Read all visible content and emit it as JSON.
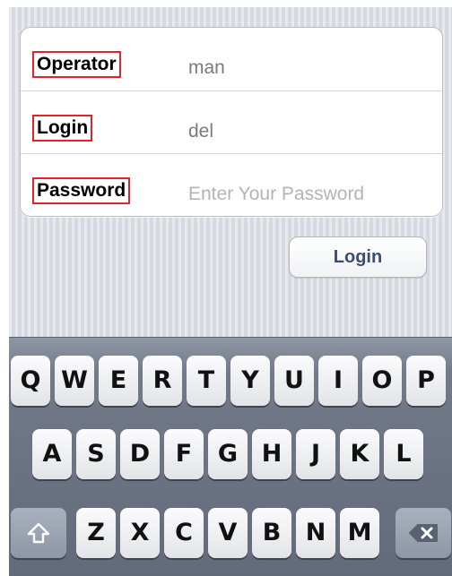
{
  "form": {
    "operator": {
      "label": "Operator",
      "value": "man"
    },
    "login": {
      "label": "Login",
      "value": "del"
    },
    "password": {
      "label": "Password",
      "placeholder": "Enter Your Password"
    }
  },
  "login_button": {
    "label": "Login"
  },
  "keyboard": {
    "row1": [
      "Q",
      "W",
      "E",
      "R",
      "T",
      "Y",
      "U",
      "I",
      "O",
      "P"
    ],
    "row2": [
      "A",
      "S",
      "D",
      "F",
      "G",
      "H",
      "J",
      "K",
      "L"
    ],
    "row3": [
      "Z",
      "X",
      "C",
      "V",
      "B",
      "N",
      "M"
    ],
    "shift_icon": "shift-arrow-icon",
    "delete_icon": "backspace-icon"
  },
  "colors": {
    "label_highlight": "#e3222b",
    "button_text": "#3b4d73",
    "keyboard_bg": "#727a8a"
  }
}
